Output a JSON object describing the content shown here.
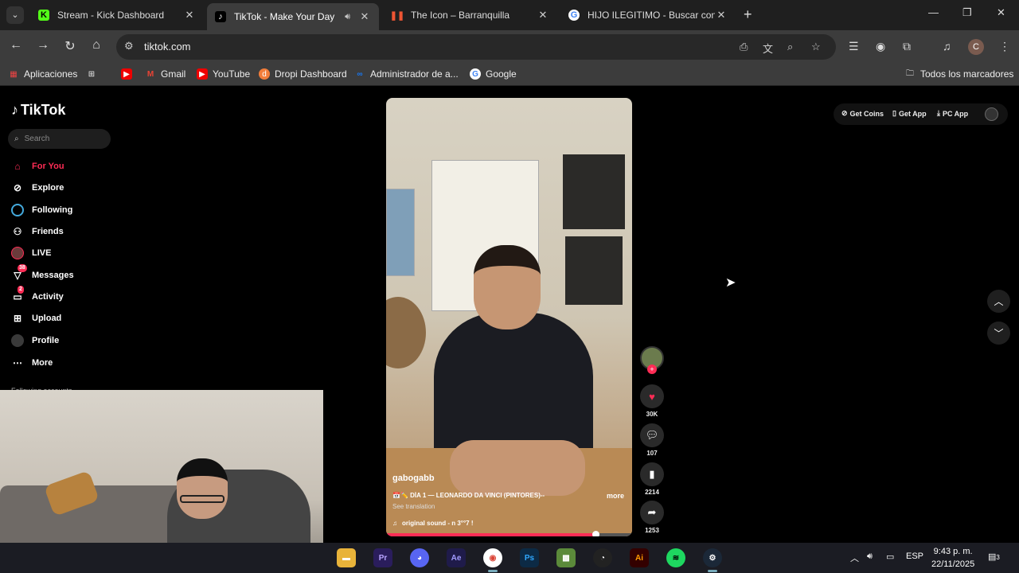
{
  "browser": {
    "tabs": [
      {
        "title": "Stream - Kick Dashboard",
        "favicon": "kick-icon",
        "active": false
      },
      {
        "title": "TikTok - Make Your Day",
        "favicon": "tiktok-icon",
        "active": true
      },
      {
        "title": "The Icon – Barranquilla",
        "favicon": "pause-icon",
        "active": false
      },
      {
        "title": "HIJO ILEGITIMO - Buscar con G",
        "favicon": "google-icon",
        "active": false
      }
    ],
    "url": "tiktok.com",
    "bookmarks": [
      {
        "label": "Aplicaciones",
        "icon": "apps-grid-icon"
      },
      {
        "label": "",
        "icon": "grid-icon"
      },
      {
        "label": "",
        "icon": "youtube-icon"
      },
      {
        "label": "Gmail",
        "icon": "gmail-icon"
      },
      {
        "label": "YouTube",
        "icon": "youtube-icon"
      },
      {
        "label": "Dropi Dashboard",
        "icon": "dropi-icon"
      },
      {
        "label": "Administrador de a...",
        "icon": "meta-icon"
      },
      {
        "label": "Google",
        "icon": "google-icon"
      }
    ],
    "all_bookmarks": "Todos los marcadores",
    "profile_initial": "C"
  },
  "tiktok": {
    "logo": "TikTok",
    "search_placeholder": "Search",
    "nav": [
      {
        "label": "For You",
        "icon": "home-icon",
        "active": true
      },
      {
        "label": "Explore",
        "icon": "compass-icon"
      },
      {
        "label": "Following",
        "icon": "following-icon"
      },
      {
        "label": "Friends",
        "icon": "friends-icon"
      },
      {
        "label": "LIVE",
        "icon": "live-icon"
      },
      {
        "label": "Messages",
        "icon": "messages-icon",
        "badge": "38"
      },
      {
        "label": "Activity",
        "icon": "activity-icon",
        "badge": "2"
      },
      {
        "label": "Upload",
        "icon": "upload-icon"
      },
      {
        "label": "Profile",
        "icon": "profile-icon"
      },
      {
        "label": "More",
        "icon": "more-icon"
      }
    ],
    "following_accounts": "Following accounts",
    "top_actions": [
      "Get Coins",
      "Get App",
      "PC App"
    ],
    "video": {
      "username": "gabogabb",
      "caption": "DÍA 1 — LEONARDO DA VINCI (PINTORES)--",
      "more": "more",
      "see_translation": "See translation",
      "sound": "original sound - n 3°°7 !",
      "progress": 0.85
    },
    "actions": {
      "likes": "30K",
      "comments": "107",
      "saves": "2214",
      "shares": "1253"
    },
    "accent": "#fe2c55"
  },
  "taskbar": {
    "apps": [
      "File Explorer",
      "Premiere Pro",
      "Discord",
      "After Effects",
      "Chrome",
      "Photoshop",
      "Minecraft",
      "OBS",
      "Illustrator",
      "Spotify",
      "Steam"
    ],
    "language": "ESP",
    "time": "9:43 p. m.",
    "date": "22/11/2025",
    "notifications": "3"
  }
}
